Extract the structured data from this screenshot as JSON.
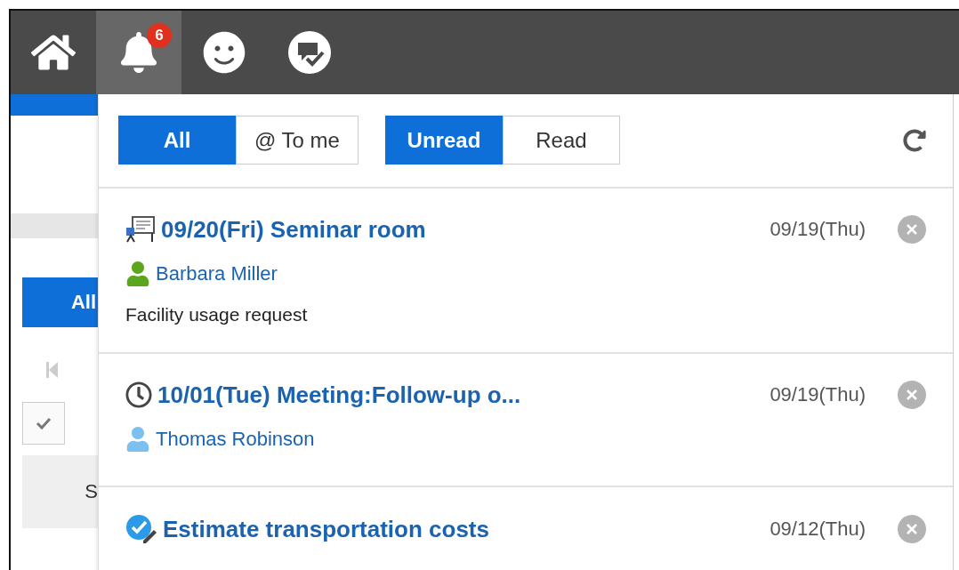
{
  "top_bar": {
    "icons": [
      {
        "kind": "home",
        "selected": false
      },
      {
        "kind": "bell",
        "selected": true,
        "badge": "6"
      },
      {
        "kind": "smile",
        "selected": false
      },
      {
        "kind": "chat",
        "selected": false
      }
    ]
  },
  "background": {
    "button": "All",
    "checked": true,
    "side_text": "S"
  },
  "notifications": {
    "scope_tabs": [
      {
        "label": "All",
        "selected": true
      },
      {
        "label": "@ To me",
        "selected": false
      }
    ],
    "status_tabs": [
      {
        "label": "Unread",
        "selected": true
      },
      {
        "label": "Read",
        "selected": false
      }
    ],
    "items": [
      {
        "kind": "facility",
        "title": "09/20(Fri) Seminar room",
        "date": "09/19(Thu)",
        "sender": "Barbara Miller",
        "color": "#5ba61c",
        "description": "Facility usage request"
      },
      {
        "kind": "schedule",
        "title": "10/01(Tue) Meeting:Follow-up o...",
        "date": "09/19(Thu)",
        "sender": "Thomas Robinson",
        "color": "#7cc0f0"
      },
      {
        "kind": "todo",
        "title": "Estimate transportation costs",
        "date": "09/12(Thu)"
      }
    ]
  }
}
